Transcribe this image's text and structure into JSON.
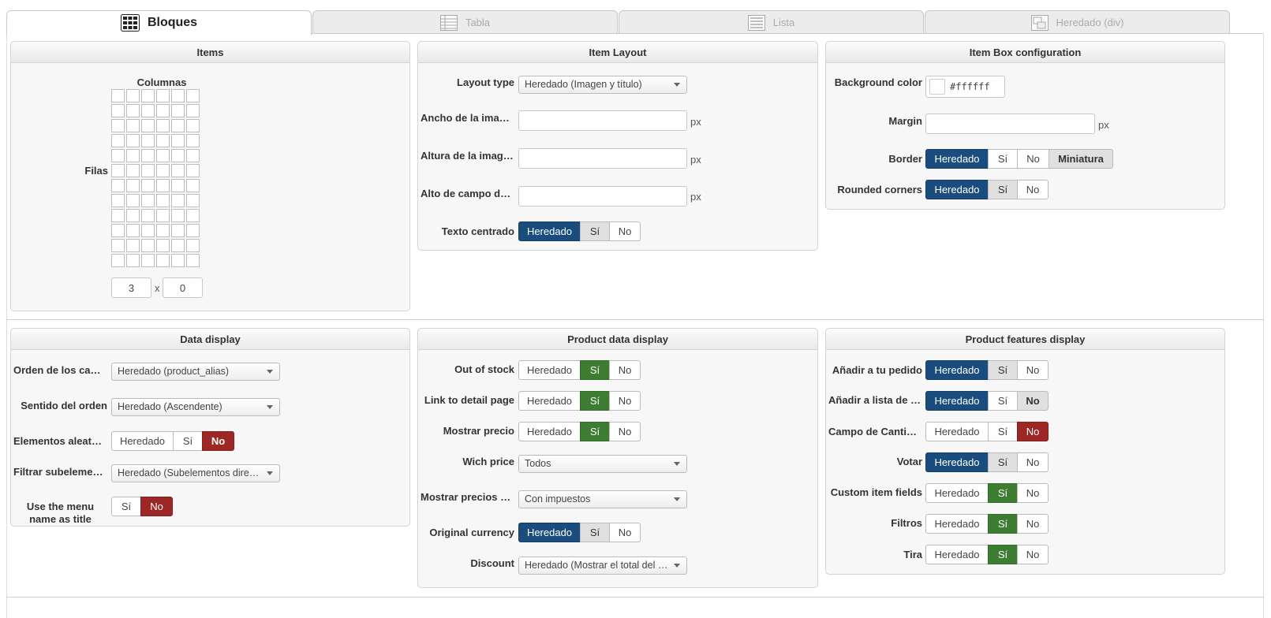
{
  "tabs": [
    {
      "label": "Bloques",
      "icon": "blocks-icon",
      "active": true
    },
    {
      "label": "Tabla",
      "icon": "table-icon",
      "active": false
    },
    {
      "label": "Lista",
      "icon": "list-icon",
      "active": false
    },
    {
      "label": "Heredado (div)",
      "icon": "div-icon",
      "active": false
    }
  ],
  "items": {
    "title": "Items",
    "columns_label": "Columnas",
    "rows_label": "Filas",
    "columns_value": "3",
    "rows_value": "0",
    "x": "x"
  },
  "item_layout": {
    "title": "Item Layout",
    "layout_type_label": "Layout type",
    "layout_type_value": "Heredado (Imagen y título)",
    "image_width_label": "Ancho de la imagen",
    "image_height_label": "Altura de la imagen",
    "field_height_label": "Alto de campo de título",
    "unit": "px",
    "centered_label": "Texto centrado",
    "centered_options": [
      "Heredado",
      "Sí",
      "No"
    ]
  },
  "item_box": {
    "title": "Item Box configuration",
    "bg_label": "Background color",
    "bg_value": "#ffffff",
    "margin_label": "Margin",
    "unit": "px",
    "border_label": "Border",
    "border_options": [
      "Heredado",
      "Sí",
      "No",
      "Miniatura"
    ],
    "rounded_label": "Rounded corners",
    "rounded_options": [
      "Heredado",
      "Sí",
      "No"
    ]
  },
  "data_display": {
    "title": "Data display",
    "order_label": "Orden de los campos",
    "order_value": "Heredado (product_alias)",
    "direction_label": "Sentido del orden",
    "direction_value": "Heredado (Ascendente)",
    "random_label": "Elementos aleatorios",
    "random_options": [
      "Heredado",
      "Sí",
      "No"
    ],
    "filter_label": "Filtrar subelementos",
    "filter_value": "Heredado (Subelementos directos)",
    "menu_title_label_1": "Use the menu",
    "menu_title_label_2": "name as title",
    "menu_title_options": [
      "Sí",
      "No"
    ]
  },
  "product_data": {
    "title": "Product data display",
    "out_of_stock_label": "Out of stock",
    "link_label": "Link to detail page",
    "price_label": "Mostrar precio",
    "which_price_label": "Wich price",
    "which_price_value": "Todos",
    "taxes_label": "Mostrar precios con impuestos",
    "taxes_value": "Con impuestos",
    "currency_label": "Original currency",
    "discount_label": "Discount",
    "discount_value": "Heredado (Mostrar el total del descuento)",
    "options": [
      "Heredado",
      "Sí",
      "No"
    ]
  },
  "product_features": {
    "title": "Product features display",
    "add_order_label": "Añadir a tu pedido",
    "add_wishlist_label": "Añadir a lista de deseos",
    "qty_label": "Campo de Cantidad",
    "vote_label": "Votar",
    "custom_label": "Custom item fields",
    "filters_label": "Filtros",
    "strip_label": "Tira",
    "options": [
      "Heredado",
      "Sí",
      "No"
    ]
  },
  "colors": {
    "blue": "#1a4d7e",
    "green": "#3c7d32",
    "red": "#9c2724"
  }
}
